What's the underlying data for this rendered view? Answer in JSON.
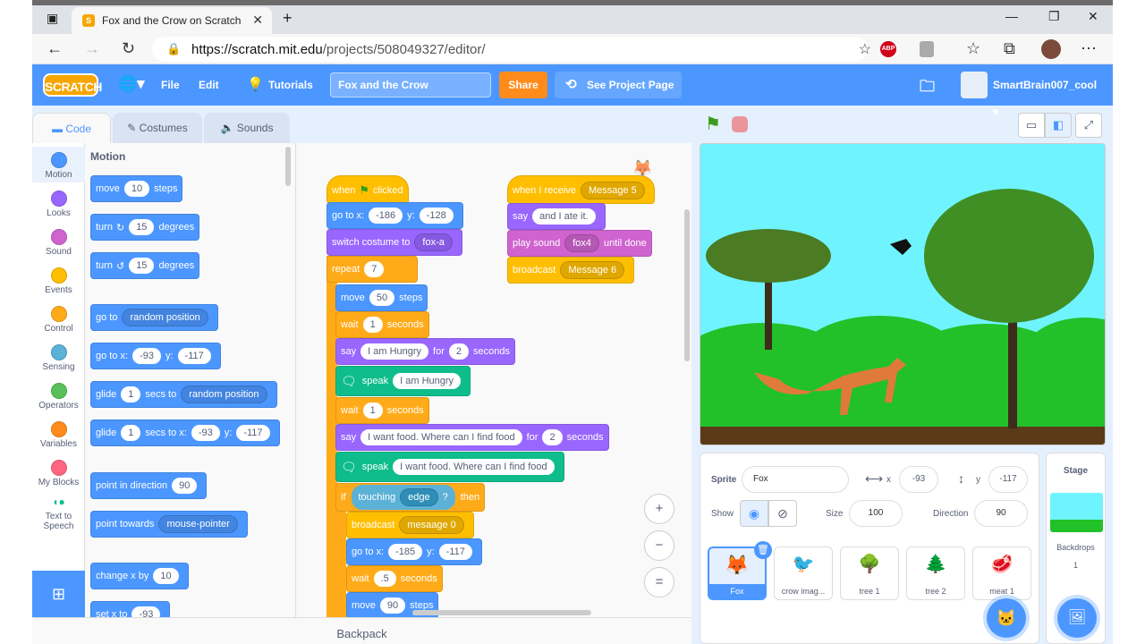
{
  "browser": {
    "tab_title": "Fox and the Crow on Scratch",
    "url_host": "https://scratch.mit.edu",
    "url_path": "/projects/508049327/editor/"
  },
  "menubar": {
    "logo": "SCRATCH",
    "file": "File",
    "edit": "Edit",
    "tutorials": "Tutorials",
    "project_title": "Fox and the Crow",
    "share": "Share",
    "see_project": "See Project Page",
    "username": "SmartBrain007_cool"
  },
  "tabs": {
    "code": "Code",
    "costumes": "Costumes",
    "sounds": "Sounds"
  },
  "categories": [
    {
      "label": "Motion",
      "color": "#4c97ff"
    },
    {
      "label": "Looks",
      "color": "#9966ff"
    },
    {
      "label": "Sound",
      "color": "#cf63cf"
    },
    {
      "label": "Events",
      "color": "#ffbf00"
    },
    {
      "label": "Control",
      "color": "#ffab19"
    },
    {
      "label": "Sensing",
      "color": "#5cb1d6"
    },
    {
      "label": "Operators",
      "color": "#59c059"
    },
    {
      "label": "Variables",
      "color": "#ff8c1a"
    },
    {
      "label": "My Blocks",
      "color": "#ff6680"
    },
    {
      "label": "Text to Speech",
      "color": "#0fbd8c"
    }
  ],
  "palette": {
    "heading": "Motion",
    "move": {
      "a": "move",
      "n": "10",
      "b": "steps"
    },
    "turn_r": {
      "a": "turn",
      "n": "15",
      "b": "degrees"
    },
    "turn_l": {
      "a": "turn",
      "n": "15",
      "b": "degrees"
    },
    "goto": {
      "a": "go to",
      "d": "random position"
    },
    "gotoxy": {
      "a": "go to x:",
      "x": "-93",
      "y_lbl": "y:",
      "y": "-117"
    },
    "glide1": {
      "a": "glide",
      "n": "1",
      "b": "secs to",
      "d": "random position"
    },
    "glide2": {
      "a": "glide",
      "n": "1",
      "b": "secs to x:",
      "x": "-93",
      "y_lbl": "y:",
      "y": "-117"
    },
    "point_dir": {
      "a": "point in direction",
      "n": "90"
    },
    "point_tow": {
      "a": "point towards",
      "d": "mouse-pointer"
    },
    "change_x": {
      "a": "change x by",
      "n": "10"
    },
    "set_x": {
      "a": "set x to",
      "n": "-93"
    }
  },
  "script1": {
    "hat": {
      "a": "when",
      "b": "clicked"
    },
    "gotoxy": {
      "a": "go to x:",
      "x": "-186",
      "y_lbl": "y:",
      "y": "-128"
    },
    "costume": {
      "a": "switch costume to",
      "d": "fox-a"
    },
    "repeat": {
      "a": "repeat",
      "n": "7"
    },
    "move": {
      "a": "move",
      "n": "50",
      "b": "steps"
    },
    "wait1": {
      "a": "wait",
      "n": "1",
      "b": "seconds"
    },
    "say1": {
      "a": "say",
      "t": "I am Hungry",
      "b": "for",
      "n": "2",
      "c": "seconds"
    },
    "speak1": {
      "a": "speak",
      "t": "I am Hungry"
    },
    "wait2": {
      "a": "wait",
      "n": "1",
      "b": "seconds"
    },
    "say2": {
      "a": "say",
      "t": "I want food. Where can I find food",
      "b": "for",
      "n": "2",
      "c": "seconds"
    },
    "speak2": {
      "a": "speak",
      "t": "I want food. Where can I find food"
    },
    "if": {
      "a": "if",
      "s": "touching",
      "d": "edge",
      "q": "?",
      "b": "then"
    },
    "broadcast": {
      "a": "broadcast",
      "d": "mesaage 0"
    },
    "gotoxy2": {
      "a": "go to x:",
      "x": "-185",
      "y_lbl": "y:",
      "y": "-117"
    },
    "wait3": {
      "a": "wait",
      "n": ".5",
      "b": "seconds"
    },
    "move2": {
      "a": "move",
      "n": "90",
      "b": "steps"
    }
  },
  "script2": {
    "hat": {
      "a": "when I receive",
      "d": "Message 5"
    },
    "say": {
      "a": "say",
      "t": "and I ate it."
    },
    "sound": {
      "a": "play sound",
      "d": "fox4",
      "b": "until done"
    },
    "broadcast": {
      "a": "broadcast",
      "d": "Message 6"
    }
  },
  "zoom": {
    "in": "+",
    "out": "−",
    "reset": "="
  },
  "backpack": "Backpack",
  "sprite_info": {
    "sprite_lbl": "Sprite",
    "sprite_name": "Fox",
    "x_lbl": "x",
    "x": "-93",
    "y_lbl": "y",
    "y": "-117",
    "show_lbl": "Show",
    "size_lbl": "Size",
    "size": "100",
    "dir_lbl": "Direction",
    "dir": "90"
  },
  "sprites": [
    {
      "name": "Fox",
      "selected": true
    },
    {
      "name": "crow imag..."
    },
    {
      "name": "tree 1"
    },
    {
      "name": "tree 2"
    },
    {
      "name": "meat 1"
    }
  ],
  "stage_pane": {
    "title": "Stage",
    "backdrops_lbl": "Backdrops",
    "backdrops_count": "1"
  },
  "colors": {
    "accent": "#4c97ff",
    "motion": "#4c97ff",
    "looks": "#9966ff",
    "sound": "#cf63cf",
    "events": "#ffbf00",
    "control": "#ffab19",
    "sensing": "#5cb1d6",
    "extension": "#0fbd8c"
  }
}
